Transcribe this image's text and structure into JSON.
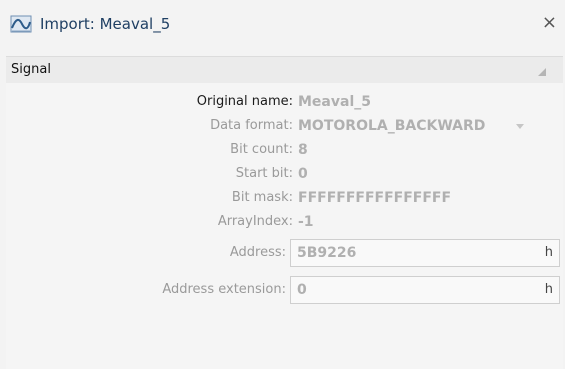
{
  "window": {
    "title": "Import: Meaval_5",
    "icon": "signal-wave-icon",
    "close_label": "×"
  },
  "section": {
    "title": "Signal",
    "collapse_icon": "collapse-triangle-icon"
  },
  "properties": [
    {
      "label": "Original name:",
      "value": "Meaval_5"
    },
    {
      "label": "Data format:",
      "value": "MOTOROLA_BACKWARD"
    },
    {
      "label": "Bit count:",
      "value": "8"
    },
    {
      "label": "Start bit:",
      "value": "0"
    },
    {
      "label": "Bit mask:",
      "value": "FFFFFFFFFFFFFFFF"
    },
    {
      "label": "ArrayIndex:",
      "value": "-1"
    }
  ],
  "fields": [
    {
      "label": "Address:",
      "value": "5B9226",
      "suffix": "h"
    },
    {
      "label": "Address extension:",
      "value": "0",
      "suffix": "h"
    }
  ],
  "colors": {
    "title": "#1f3f63",
    "disabled_text": "#9a9a9a",
    "background": "#f3f3f3"
  }
}
